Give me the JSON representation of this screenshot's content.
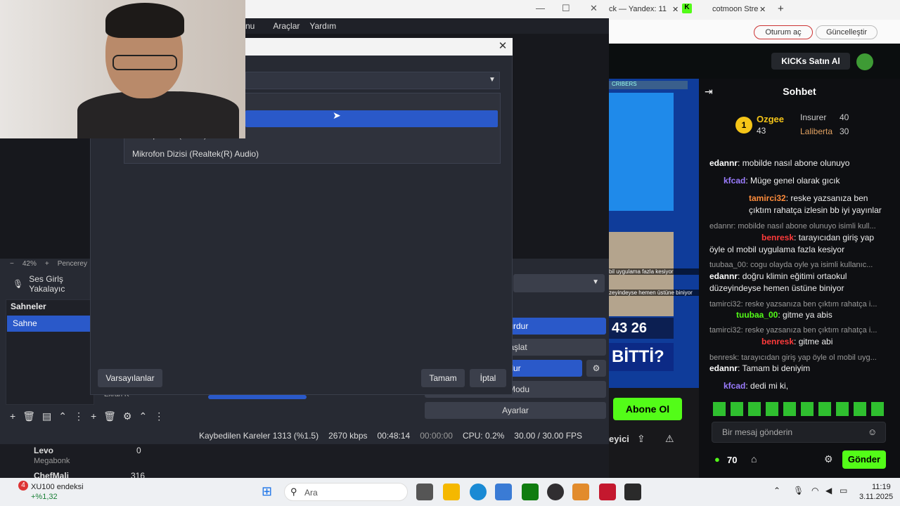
{
  "obs": {
    "menu": [
      "nu",
      "Araçlar",
      "Yardım"
    ],
    "zoom": {
      "minus": "−",
      "percent": "42%",
      "plus": "+",
      "label": "Pencerey"
    },
    "audio_source": "Ses Girlş Yakalayıc",
    "scenes_header": "Sahneler",
    "scene_selected": "Sahne",
    "mixer_label": "Ekran K",
    "controls": [
      "Durdur",
      "Başlat",
      "yı Durdur",
      "o Modu",
      "Ayarlar"
    ],
    "status": {
      "dropped": "Kaybedilen Kareler 1313 (%1.5)",
      "bitrate": "2670 kbps",
      "rec_time": "00:48:14",
      "stream_time": "00:00:00",
      "cpu": "CPU: 0.2%",
      "fps": "30.00 / 30.00 FPS"
    }
  },
  "dialog": {
    "list_partial": "Microphone (Camo)",
    "list_item": "Mikrofon Dizisi (Realtek(R) Audio)",
    "defaults_button": "Varsayılanlar",
    "ok_button": "Tamam",
    "cancel_button": "İptal",
    "close_glyph": "✕"
  },
  "browser": {
    "tab1": "ck — Yandex: 11",
    "tab2": "cotmoon Stre",
    "login_pill": "Oturum aç",
    "update_pill": "Güncelleştir",
    "kick_buy": "KICKs Satın Al",
    "chat_title": "Sohbet",
    "top_gifters": [
      {
        "name": "Ozgee",
        "count": "43"
      },
      {
        "name": "Insurer",
        "count": "40"
      },
      {
        "name": "Laliberta",
        "count": "30"
      }
    ],
    "stream_caption1": "bil uygulama fazla kesiyor",
    "stream_caption2": "zeyindeyse hemen üstüne biniyor",
    "stream_number": "43 26",
    "stream_question": "BİTTİ?",
    "stream_banner": "CRIBERS",
    "messages": [
      {
        "user": "edannr",
        "text": "mobilde nasıl abone olunuyo"
      },
      {
        "user": "kfcad",
        "text": "Müge genel olarak gıcık"
      },
      {
        "user": "tamirci32",
        "text": "reske yazsanıza ben çıktım rahatça izlesin bb iyi yayınlar"
      },
      {
        "reply": "edannr: mobilde nasıl abone olunuyo isimli kull...",
        "user": "benresk",
        "text": "tarayıcıdan giriş yap öyle ol mobil uygulama fazla kesiyor"
      },
      {
        "reply": "tuubaa_00: cogu olayda oyle ya isimli kullanıc...",
        "user": "edannr",
        "text": "doğru klimin eğitimi ortaokul düzeyindeyse hemen üstüne biniyor"
      },
      {
        "reply": "tamirci32: reske yazsanıza ben çıktım rahatça i...",
        "user": "tuubaa_00",
        "text": "gitme ya abis"
      },
      {
        "reply": "tamirci32: reske yazsanıza ben çıktım rahatça i...",
        "user": "benresk",
        "text": "gitme abi"
      },
      {
        "reply": "benresk: tarayıcıdan giriş yap öyle ol mobil uyg...",
        "user": "edannr",
        "text": "Tamam bi deniyim"
      },
      {
        "user": "kfcad",
        "text": "dedi mi ki,"
      }
    ],
    "abone_button": "Abone Ol",
    "chat_placeholder": "Bir mesaj gönderin",
    "points": "70",
    "send_button": "Gönder",
    "viewers_label": "eyici"
  },
  "lower": {
    "user1": "Levo",
    "user1_sub": "Megabonk",
    "user1_count": "0",
    "user2": "ChefMali",
    "user2_count": "316"
  },
  "taskbar": {
    "widget_title": "XU100 endeksi",
    "widget_value": "+%1,32",
    "widget_badge": "4",
    "search": "Ara",
    "time": "11:19",
    "date": "3.11.2025"
  }
}
